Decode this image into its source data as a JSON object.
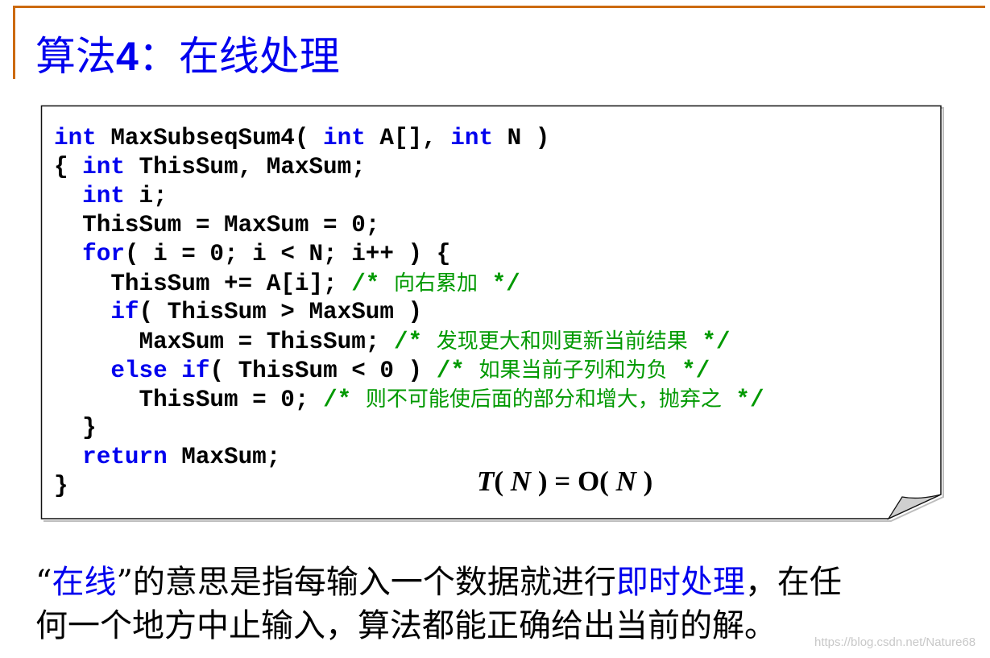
{
  "slide": {
    "title_prefix": "算法",
    "title_number": "4",
    "title_sep": "：",
    "title_main": "在线处理",
    "accent_color": "#cc6a10",
    "title_color": "#0000ee"
  },
  "code": {
    "keyword_color": "#0000ee",
    "comment_color": "#009900",
    "lines": [
      {
        "indent": "",
        "kw1": "int",
        "text1": " MaxSubseqSum4( ",
        "kw2": "int",
        "text2": " A[], ",
        "kw3": "int",
        "text3": " N )",
        "comment_open": "",
        "comment_text": "",
        "comment_close": ""
      },
      {
        "indent": "{ ",
        "kw1": "int",
        "text1": " ThisSum, MaxSum;",
        "kw2": "",
        "text2": "",
        "kw3": "",
        "text3": "",
        "comment_open": "",
        "comment_text": "",
        "comment_close": ""
      },
      {
        "indent": "  ",
        "kw1": "int",
        "text1": " i;",
        "kw2": "",
        "text2": "",
        "kw3": "",
        "text3": "",
        "comment_open": "",
        "comment_text": "",
        "comment_close": ""
      },
      {
        "indent": "  ",
        "kw1": "",
        "text1": "ThisSum = MaxSum = 0;",
        "kw2": "",
        "text2": "",
        "kw3": "",
        "text3": "",
        "comment_open": "",
        "comment_text": "",
        "comment_close": ""
      },
      {
        "indent": "  ",
        "kw1": "for",
        "text1": "( i = 0; i < N; i++ ) {",
        "kw2": "",
        "text2": "",
        "kw3": "",
        "text3": "",
        "comment_open": "",
        "comment_text": "",
        "comment_close": ""
      },
      {
        "indent": "    ",
        "kw1": "",
        "text1": "ThisSum += A[i]; ",
        "kw2": "",
        "text2": "",
        "kw3": "",
        "text3": "",
        "comment_open": "/* ",
        "comment_text": "向右累加",
        "comment_close": " */"
      },
      {
        "indent": "    ",
        "kw1": "if",
        "text1": "( ThisSum > MaxSum )",
        "kw2": "",
        "text2": "",
        "kw3": "",
        "text3": "",
        "comment_open": "",
        "comment_text": "",
        "comment_close": ""
      },
      {
        "indent": "      ",
        "kw1": "",
        "text1": "MaxSum = ThisSum; ",
        "kw2": "",
        "text2": "",
        "kw3": "",
        "text3": "",
        "comment_open": "/* ",
        "comment_text": "发现更大和则更新当前结果",
        "comment_close": " */"
      },
      {
        "indent": "    ",
        "kw1": "else",
        "text1": " ",
        "kw2": "if",
        "text2": "( ThisSum < 0 ) ",
        "kw3": "",
        "text3": "",
        "comment_open": "/* ",
        "comment_text": "如果当前子列和为负",
        "comment_close": " */"
      },
      {
        "indent": "      ",
        "kw1": "",
        "text1": "ThisSum = 0; ",
        "kw2": "",
        "text2": "",
        "kw3": "",
        "text3": "",
        "comment_open": "/* ",
        "comment_text": "则不可能使后面的部分和增大，抛弃之",
        "comment_close": " */"
      },
      {
        "indent": "  ",
        "kw1": "",
        "text1": "}",
        "kw2": "",
        "text2": "",
        "kw3": "",
        "text3": "",
        "comment_open": "",
        "comment_text": "",
        "comment_close": ""
      },
      {
        "indent": "  ",
        "kw1": "return",
        "text1": " MaxSum;",
        "kw2": "",
        "text2": "",
        "kw3": "",
        "text3": "",
        "comment_open": "",
        "comment_text": "",
        "comment_close": ""
      },
      {
        "indent": "",
        "kw1": "",
        "text1": "}",
        "kw2": "",
        "text2": "",
        "kw3": "",
        "text3": "",
        "comment_open": "",
        "comment_text": "",
        "comment_close": ""
      }
    ]
  },
  "complexity": {
    "lhs_fn": "T",
    "lhs_open": "( ",
    "lhs_arg": "N",
    "lhs_close": " )",
    "equals": " = ",
    "rhs_fn": "O",
    "rhs_open": "( ",
    "rhs_arg": "N",
    "rhs_close": " )"
  },
  "explanation": {
    "line1": {
      "quote_open": "“",
      "term": "在线",
      "quote_close": "”",
      "text_a": "的意思是指每输入一个数据就进行",
      "highlight": "即时处理",
      "text_b": "，在任"
    },
    "line2": "何一个地方中止输入，算法都能正确给出当前的解。",
    "highlight_color": "#0000ee"
  },
  "watermark": "https://blog.csdn.net/Nature68"
}
